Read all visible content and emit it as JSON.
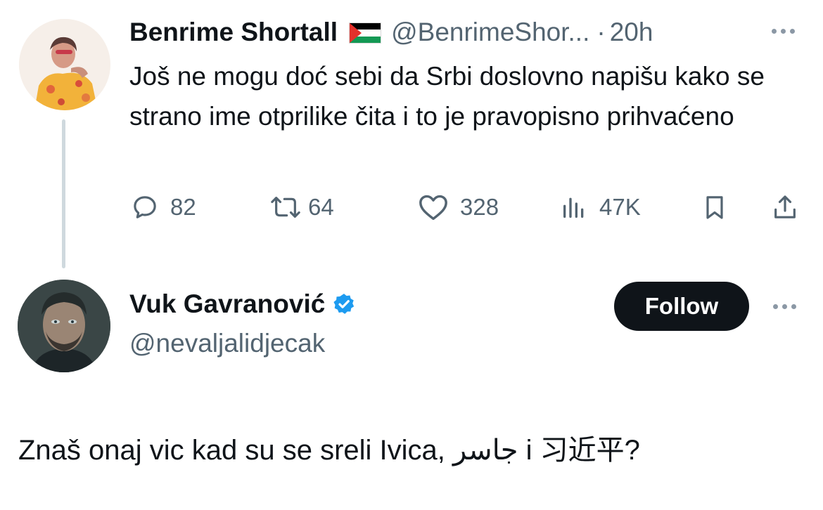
{
  "tweet": {
    "author_name": "Benrime Shortall",
    "flag_icon": "palestine-flag-icon",
    "handle": "@BenrimeShor...",
    "separator": "·",
    "time": "20h",
    "text": "Još ne mogu doć sebi da Srbi doslovno napišu kako se strano ime otprilike čita i to je pravopisno prihvaćeno",
    "stats": {
      "replies": "82",
      "retweets": "64",
      "likes": "328",
      "views": "47K"
    }
  },
  "reply": {
    "author_name": "Vuk Gavranović",
    "verified_icon": "verified-badge-icon",
    "handle": "@nevaljalidjecak",
    "follow_label": "Follow",
    "text": "Znaš onaj vic kad su se sreli Ivica, جاسر i 习近平?"
  },
  "colors": {
    "text": "#0f1419",
    "muted": "#536471",
    "verified": "#1d9bf0",
    "follow_bg": "#0f1419",
    "thread_line": "#cfd9de"
  }
}
